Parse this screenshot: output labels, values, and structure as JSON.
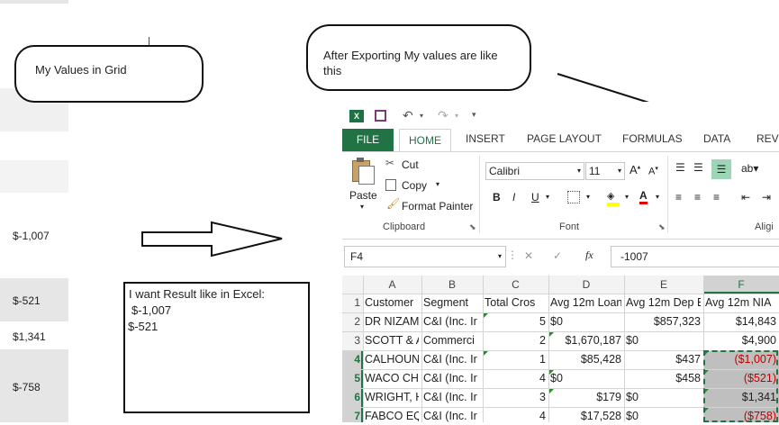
{
  "left_grid": {
    "values": [
      "$-1,007",
      "$-521",
      "$1,341",
      "$-758"
    ]
  },
  "callouts": {
    "grid": "My Values in Grid",
    "export": "After Exporting My values are like this",
    "result": {
      "line1": "I want Result like in Excel:",
      "line2": "$-1,007",
      "line3": "$-521"
    }
  },
  "excel": {
    "tabs": {
      "file": "FILE",
      "home": "HOME",
      "insert": "INSERT",
      "page_layout": "PAGE LAYOUT",
      "formulas": "FORMULAS",
      "data": "DATA",
      "review": "REVI"
    },
    "clipboard": {
      "paste": "Paste",
      "cut": "Cut",
      "copy": "Copy",
      "format_painter": "Format Painter",
      "group": "Clipboard"
    },
    "font": {
      "name": "Calibri",
      "size": "11",
      "group": "Font"
    },
    "align_group": "Aligi",
    "namebox": "F4",
    "formula": "-1007",
    "columns": [
      "A",
      "B",
      "C",
      "D",
      "E",
      "F"
    ],
    "rows": [
      [
        "Customer",
        "Segment",
        "Total Cros",
        "Avg 12m Loan",
        "Avg 12m Dep B",
        "Avg 12m NIA"
      ],
      [
        "DR NIZAM",
        "C&I (Inc. Ir",
        "5",
        "$0",
        "$857,323",
        "$14,843"
      ],
      [
        "SCOTT & A",
        "Commerci",
        "2",
        "$1,670,187",
        "$0",
        "$4,900"
      ],
      [
        "CALHOUN",
        "C&I (Inc. Ir",
        "1",
        "$85,428",
        "$437",
        "($1,007)"
      ],
      [
        "WACO CHI",
        "C&I (Inc. Ir",
        "4",
        "$0",
        "$458",
        "($521)"
      ],
      [
        "WRIGHT, H",
        "C&I (Inc. Ir",
        "3",
        "$179",
        "$0",
        "$1,341"
      ],
      [
        "FABCO EQ",
        "C&I (Inc. Ir",
        "4",
        "$17,528",
        "$0",
        "($758)"
      ]
    ]
  },
  "colors": {
    "excel_green": "#217346",
    "negative_red": "#c00000",
    "selection_gray": "#bfbfbf"
  }
}
